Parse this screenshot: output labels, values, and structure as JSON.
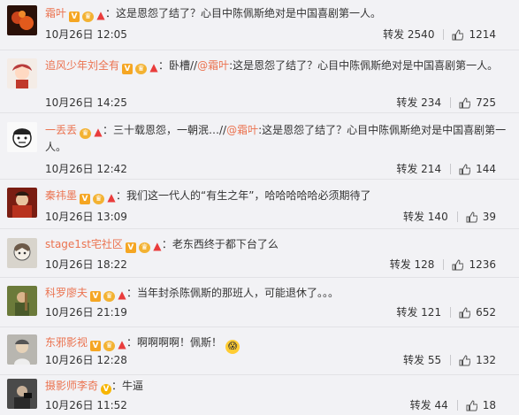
{
  "feed": {
    "items": [
      {
        "username": "霜叶",
        "badges": [
          "vip",
          "crown",
          "fire"
        ],
        "text": "：这是恩怨了结了？心目中陈佩斯绝对是中国喜剧第一人。",
        "time": "10月26日 12:05",
        "repost_label": "转发 2540",
        "likes": "1214"
      },
      {
        "username": "追风少年刘全有",
        "badges": [
          "vip",
          "crown",
          "fire"
        ],
        "text": "：卧槽//",
        "mention": "@霜叶",
        "text2": ":这是恩怨了结了？心目中陈佩斯绝对是中国喜剧第一人。",
        "time": "10月26日 14:25",
        "repost_label": "转发 234",
        "likes": "725"
      },
      {
        "username": "一丢丢",
        "badges": [
          "crown",
          "fire"
        ],
        "text": "：三十载恩怨，一朝泯…//",
        "mention": "@霜叶",
        "text2": ":这是恩怨了结了？心目中陈佩斯绝对是中国喜剧第一人。",
        "time": "10月26日 12:42",
        "repost_label": "转发 214",
        "likes": "144"
      },
      {
        "username": "秦祎墨",
        "badges": [
          "vip",
          "crown",
          "fire"
        ],
        "text": "：我们这一代人的“有生之年”，哈哈哈哈哈必须期待了",
        "time": "10月26日 13:09",
        "repost_label": "转发 140",
        "likes": "39"
      },
      {
        "username": "stage1st宅社区",
        "badges": [
          "vip",
          "crown",
          "fire"
        ],
        "text": "：老东西终于都下台了么",
        "time": "10月26日 18:22",
        "repost_label": "转发 128",
        "likes": "1236"
      },
      {
        "username": "科罗廖夫",
        "badges": [
          "vip",
          "crown",
          "fire"
        ],
        "text": "：当年封杀陈佩斯的那班人，可能退休了。。。",
        "time": "10月26日 21:19",
        "repost_label": "转发 121",
        "likes": "652"
      },
      {
        "username": "东邪影视",
        "badges": [
          "vip",
          "crown",
          "fire"
        ],
        "text": "：啊啊啊啊！佩斯！",
        "time": "10月26日 12:28",
        "repost_label": "转发 55",
        "likes": "132"
      },
      {
        "username": "摄影师李奇",
        "badges": [
          "vip"
        ],
        "text": "：牛逼",
        "time": "10月26日 11:52",
        "repost_label": "转发 44",
        "likes": "18"
      }
    ]
  }
}
